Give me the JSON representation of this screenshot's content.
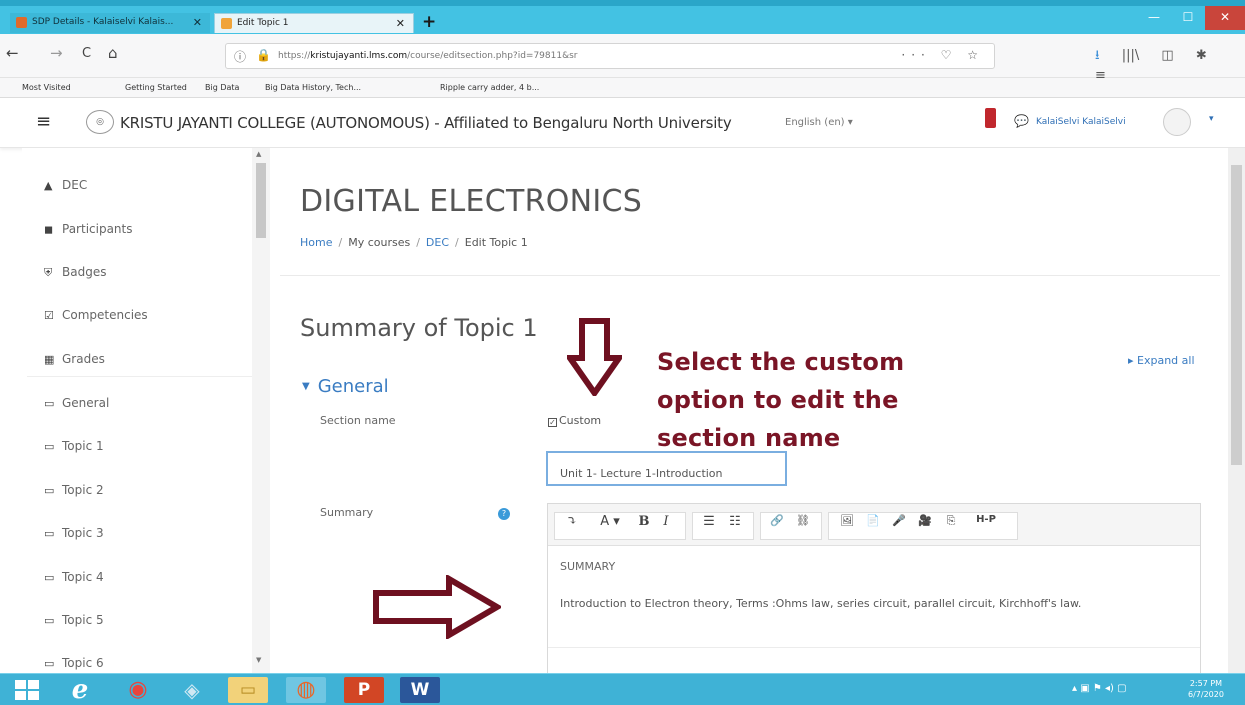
{
  "browser": {
    "tabs": [
      {
        "label": "SDP Details - Kalaiselvi Kalais...",
        "close": "✕"
      },
      {
        "label": "Edit Topic 1",
        "close": "✕"
      }
    ],
    "new_tab": "+",
    "window_controls": {
      "minimize": "—",
      "maximize": "☐",
      "close": "✕"
    },
    "nav": {
      "back": "←",
      "forward": "→",
      "reload": "C",
      "home": "⌂"
    },
    "url_prefix": "https://",
    "url_host": "kristujayanti.lms.com",
    "url_path": "/course/editsection.php?id=79811&sr",
    "url_page_actions": "··· ♡ ☆",
    "toolbar_icons": [
      "⭳",
      "|||\\",
      "◫",
      "✱",
      "≡"
    ]
  },
  "bookmarks": [
    "Most Visited",
    "Getting Started",
    "Big Data",
    "Big Data History, Tech...",
    "Ripple carry adder, 4 b..."
  ],
  "header": {
    "menu_icon": "≡",
    "site_name": "KRISTU JAYANTI COLLEGE (AUTONOMOUS) - Affiliated to Bengaluru North University",
    "language": "English (en) ▾",
    "user_name": "KalaiSelvi KalaiSelvi",
    "user_caret": "▾"
  },
  "sidebar": {
    "items": [
      {
        "icon": "graduation-cap-icon",
        "glyph": "🎓",
        "label": "DEC"
      },
      {
        "icon": "users-icon",
        "glyph": "👥",
        "label": "Participants"
      },
      {
        "icon": "shield-icon",
        "glyph": "⛨",
        "label": "Badges"
      },
      {
        "icon": "checkbox-icon",
        "glyph": "☑",
        "label": "Competencies"
      },
      {
        "icon": "table-icon",
        "glyph": "▦",
        "label": "Grades"
      },
      {
        "icon": "folder-icon",
        "glyph": "▭",
        "label": "General"
      },
      {
        "icon": "folder-icon",
        "glyph": "▭",
        "label": "Topic 1"
      },
      {
        "icon": "folder-icon",
        "glyph": "▭",
        "label": "Topic 2"
      },
      {
        "icon": "folder-icon",
        "glyph": "▭",
        "label": "Topic 3"
      },
      {
        "icon": "folder-icon",
        "glyph": "▭",
        "label": "Topic 4"
      },
      {
        "icon": "folder-icon",
        "glyph": "▭",
        "label": "Topic 5"
      },
      {
        "icon": "folder-icon",
        "glyph": "▭",
        "label": "Topic 6"
      }
    ]
  },
  "main": {
    "course_title": "DIGITAL ELECTRONICS",
    "breadcrumb": [
      "Home",
      "My courses",
      "DEC",
      "Edit Topic 1"
    ],
    "page_heading": "Summary of Topic 1",
    "expand_all": "▸ Expand all",
    "section_header": "General",
    "section_name_label": "Section name",
    "custom_checkbox": {
      "label": "Custom",
      "checked": true,
      "mark": "✓"
    },
    "section_name_value": "Unit 1- Lecture 1-Introduction",
    "summary_label": "Summary",
    "editor_toolbar": [
      "⤵",
      "A ▾",
      "B",
      "I",
      "☰",
      "☷",
      "🔗",
      "⛓",
      "🖼",
      "📄",
      "🎤",
      "🎥",
      "⎘",
      "H-P"
    ],
    "editor_heading": "SUMMARY",
    "editor_body": "Introduction to Electron theory, Terms :Ohms law, series circuit, parallel circuit, Kirchhoff's law."
  },
  "annotation": {
    "lines": [
      "Select the custom",
      "option to edit the",
      "section name"
    ],
    "color": "#7a1526"
  },
  "taskbar": {
    "apps": [
      "e",
      "◉",
      "◈",
      "▭",
      "◍",
      "P",
      "W"
    ],
    "tray": "▴ ▣ ⚑ ◂) ▢",
    "time": "2:57 PM",
    "date": "6/7/2020"
  },
  "colors": {
    "accent": "#3a7cc2",
    "titlebar": "#43c2e3",
    "annotation": "#7a1526",
    "taskbar": "#3fb2d6"
  }
}
